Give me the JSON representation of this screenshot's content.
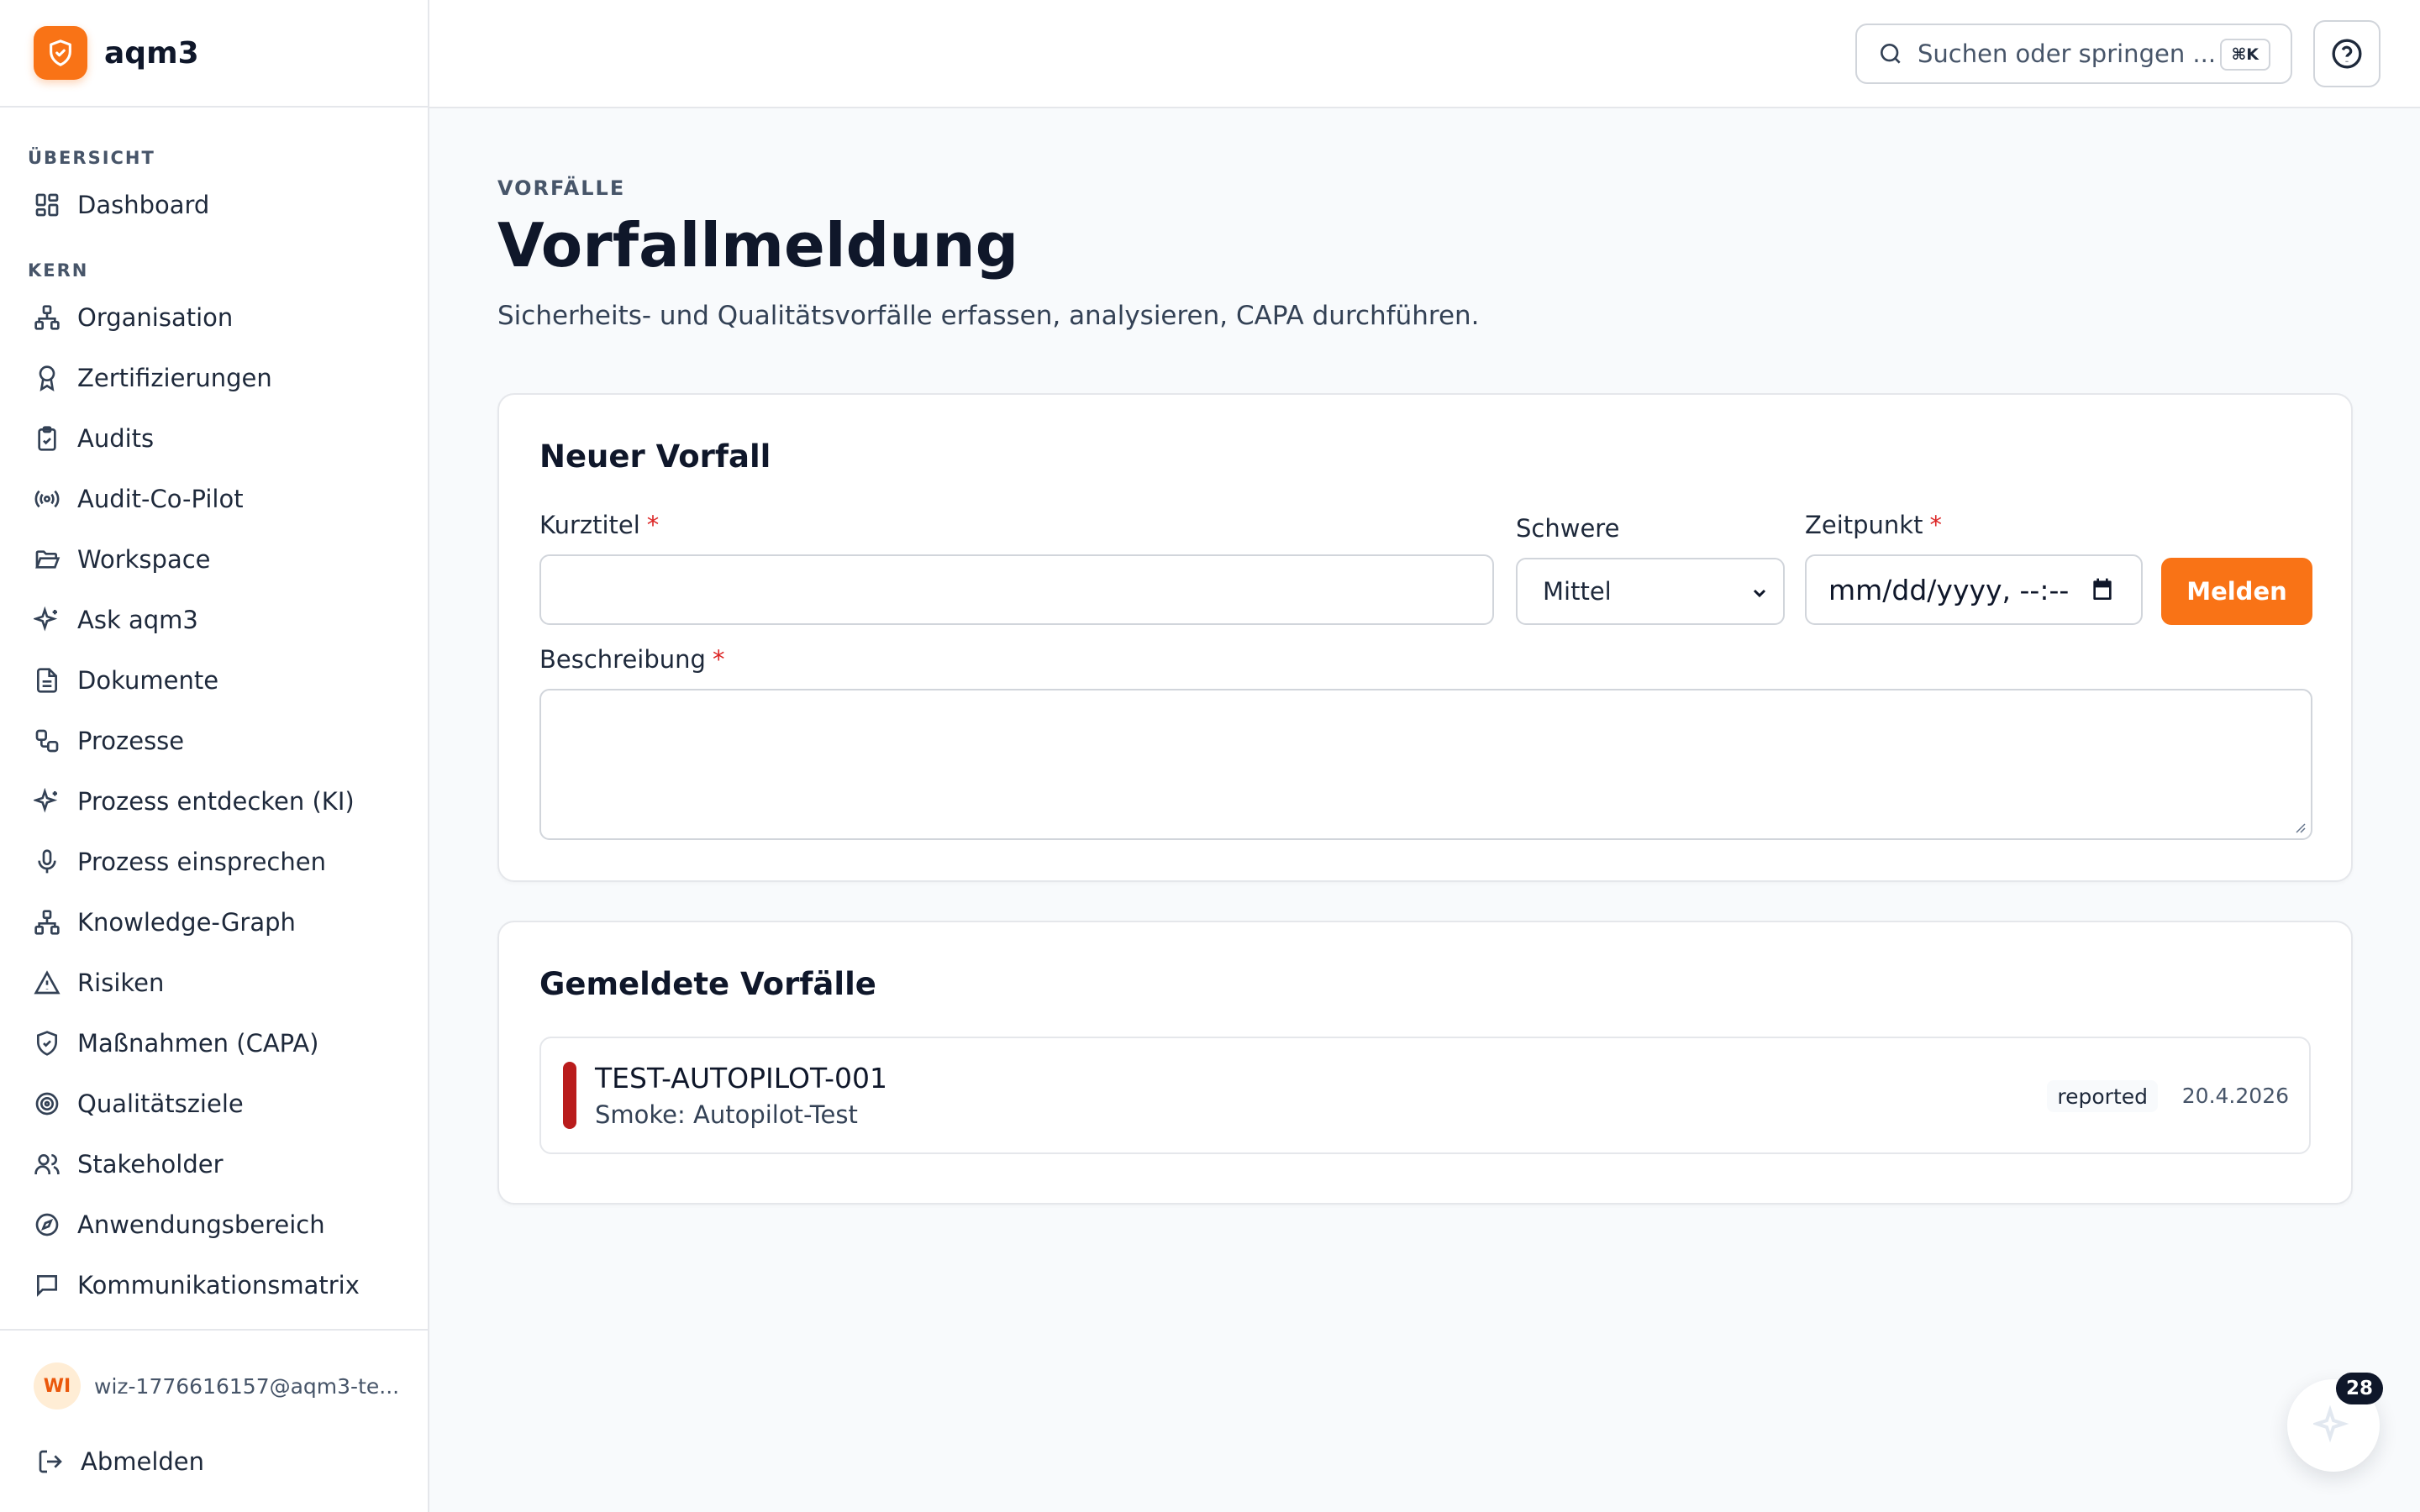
{
  "app": {
    "name": "aqm3"
  },
  "sidebar": {
    "sections": [
      {
        "label": "ÜBERSICHT",
        "items": [
          {
            "label": "Dashboard",
            "icon": "dashboard-icon"
          }
        ]
      },
      {
        "label": "KERN",
        "items": [
          {
            "label": "Organisation",
            "icon": "org-icon"
          },
          {
            "label": "Zertifizierungen",
            "icon": "award-icon"
          },
          {
            "label": "Audits",
            "icon": "clipboard-check-icon"
          },
          {
            "label": "Audit-Co-Pilot",
            "icon": "radio-icon"
          },
          {
            "label": "Workspace",
            "icon": "folder-open-icon"
          },
          {
            "label": "Ask aqm3",
            "icon": "sparkles-icon"
          },
          {
            "label": "Dokumente",
            "icon": "file-text-icon"
          },
          {
            "label": "Prozesse",
            "icon": "workflow-icon"
          },
          {
            "label": "Prozess entdecken (KI)",
            "icon": "sparkles-icon"
          },
          {
            "label": "Prozess einsprechen",
            "icon": "mic-icon"
          },
          {
            "label": "Knowledge-Graph",
            "icon": "network-icon"
          },
          {
            "label": "Risiken",
            "icon": "warning-icon"
          },
          {
            "label": "Maßnahmen (CAPA)",
            "icon": "shield-check-icon"
          },
          {
            "label": "Qualitätsziele",
            "icon": "target-icon"
          },
          {
            "label": "Stakeholder",
            "icon": "users-icon"
          },
          {
            "label": "Anwendungsbereich",
            "icon": "compass-icon"
          },
          {
            "label": "Kommunikationsmatrix",
            "icon": "message-icon"
          }
        ]
      }
    ],
    "user": {
      "initials": "WI",
      "email": "wiz-1776616157@aqm3-te..."
    },
    "logout_label": "Abmelden"
  },
  "topbar": {
    "search_placeholder": "Suchen oder springen ...",
    "search_shortcut": "⌘K"
  },
  "page": {
    "eyebrow": "VORFÄLLE",
    "title": "Vorfallmeldung",
    "subtitle": "Sicherheits- und Qualitätsvorfälle erfassen, analysieren, CAPA durchführen."
  },
  "form": {
    "title": "Neuer Vorfall",
    "title_field": {
      "label": "Kurztitel",
      "value": ""
    },
    "severity": {
      "label": "Schwere",
      "selected": "Mittel"
    },
    "datetime": {
      "label": "Zeitpunkt",
      "value": "mm/dd/yyyy, --:--"
    },
    "submit_label": "Melden",
    "description": {
      "label": "Beschreibung",
      "value": ""
    },
    "required_marker": "*"
  },
  "incidents": {
    "title": "Gemeldete Vorfälle",
    "items": [
      {
        "code": "TEST-AUTOPILOT-001",
        "title": "Smoke: Autopilot-Test",
        "status": "reported",
        "date": "20.4.2026",
        "severity_color": "#b91c1c"
      }
    ]
  },
  "assistant": {
    "badge_count": "28"
  },
  "colors": {
    "accent": "#f97316",
    "severity_high": "#b91c1c",
    "required": "#dc2626"
  }
}
